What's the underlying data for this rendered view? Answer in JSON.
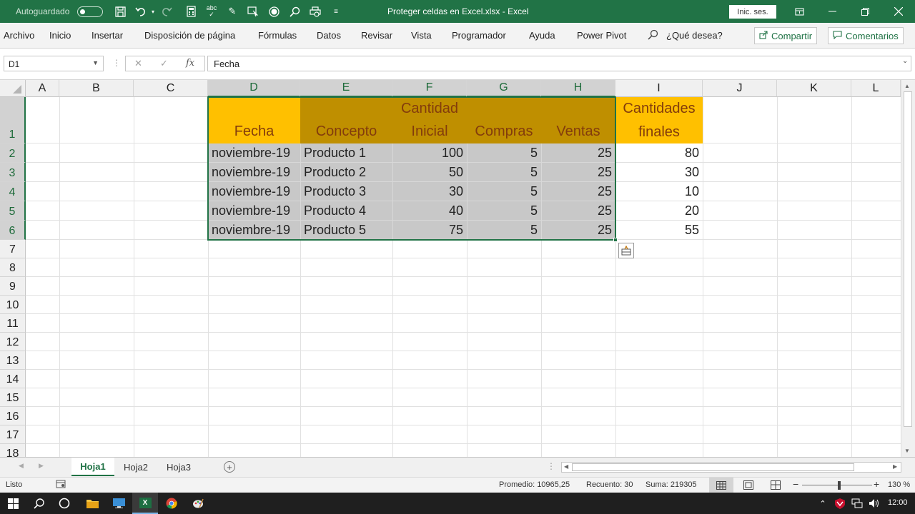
{
  "titlebar": {
    "autosave_label": "Autoguardado",
    "file_title": "Proteger celdas en Excel.xlsx  -  Excel",
    "login_label": "Inic. ses.",
    "spell_label": "abc"
  },
  "menu": {
    "items": [
      "Archivo",
      "Inicio",
      "Insertar",
      "Disposición de página",
      "Fórmulas",
      "Datos",
      "Revisar",
      "Vista",
      "Programador",
      "Ayuda",
      "Power Pivot"
    ],
    "search_placeholder": "¿Qué desea?",
    "share_label": "Compartir",
    "comments_label": "Comentarios"
  },
  "formula_bar": {
    "cell_ref": "D1",
    "fx_label": "fx",
    "value": "Fecha"
  },
  "columns": [
    "A",
    "B",
    "C",
    "D",
    "E",
    "F",
    "G",
    "H",
    "I",
    "J",
    "K",
    "L"
  ],
  "rows": [
    "1",
    "2",
    "3",
    "4",
    "5",
    "6",
    "7",
    "8",
    "9",
    "10",
    "11",
    "12",
    "13",
    "14",
    "15",
    "16",
    "17",
    "18"
  ],
  "table": {
    "headers": {
      "fecha": "Fecha",
      "concepto": "Concepto",
      "cantidad": "Cantidad",
      "inicial": "Inicial",
      "compras": "Compras",
      "ventas": "Ventas",
      "cantidades": "Cantidades",
      "finales": "finales"
    },
    "data": [
      {
        "fecha": "noviembre-19",
        "concepto": "Producto 1",
        "inicial": "100",
        "compras": "5",
        "ventas": "25",
        "finales": "80"
      },
      {
        "fecha": "noviembre-19",
        "concepto": "Producto 2",
        "inicial": "50",
        "compras": "5",
        "ventas": "25",
        "finales": "30"
      },
      {
        "fecha": "noviembre-19",
        "concepto": "Producto 3",
        "inicial": "30",
        "compras": "5",
        "ventas": "25",
        "finales": "10"
      },
      {
        "fecha": "noviembre-19",
        "concepto": "Producto 4",
        "inicial": "40",
        "compras": "5",
        "ventas": "25",
        "finales": "20"
      },
      {
        "fecha": "noviembre-19",
        "concepto": "Producto 5",
        "inicial": "75",
        "compras": "5",
        "ventas": "25",
        "finales": "55"
      }
    ]
  },
  "sheets": [
    "Hoja1",
    "Hoja2",
    "Hoja3"
  ],
  "status": {
    "ready": "Listo",
    "average": "Promedio: 10965,25",
    "count": "Recuento: 30",
    "sum": "Suma: 219305",
    "zoom": "130 %"
  },
  "taskbar": {
    "excel_label": "X",
    "time": "12:00"
  },
  "colors": {
    "accent": "#217346",
    "header_orange": "#FFC000",
    "header_dark": "#BF8F00",
    "header_text": "#833C0C",
    "selection_gray": "#C8C8C8"
  }
}
